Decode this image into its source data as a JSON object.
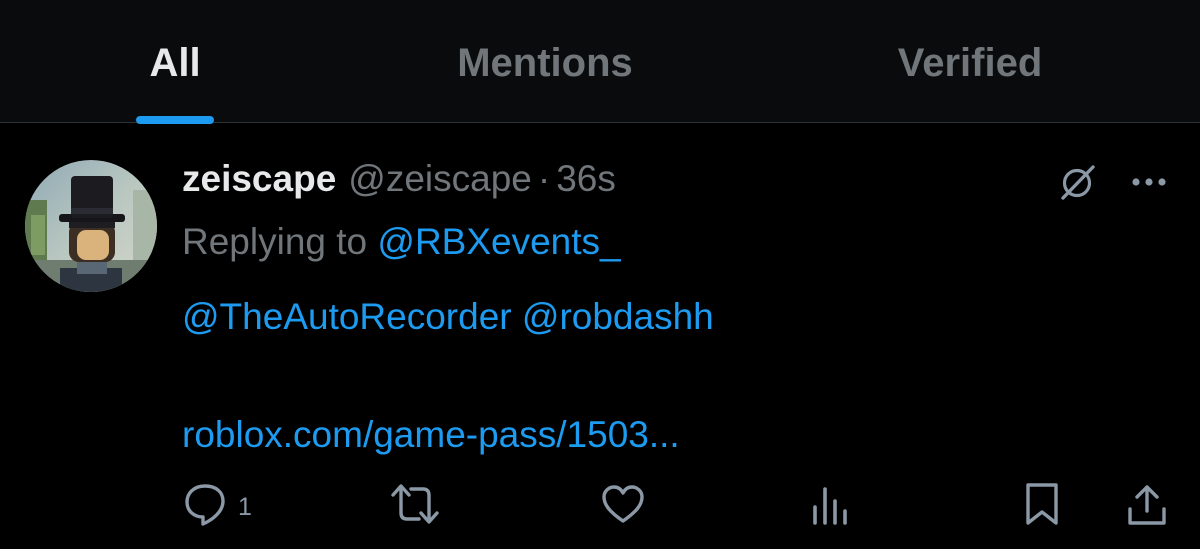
{
  "tabs": [
    {
      "label": "All",
      "active": true
    },
    {
      "label": "Mentions",
      "active": false
    },
    {
      "label": "Verified",
      "active": false
    }
  ],
  "tweet": {
    "display_name": "zeiscape",
    "handle": "@zeiscape",
    "separator": "·",
    "time": "36s",
    "replying_prefix": "Replying to ",
    "replying_to": "@RBXevents_",
    "mention_1": "@TheAutoRecorder",
    "mention_2": "@robdashh",
    "link_text": "roblox.com/game-pass/1503...",
    "reply_count": "1",
    "icons": [
      "grok-icon",
      "more-icon",
      "reply-icon",
      "retweet-icon",
      "like-icon",
      "views-icon",
      "bookmark-icon",
      "share-icon"
    ]
  },
  "colors": {
    "accent": "#1d9bf0",
    "muted": "#71767b",
    "text": "#e7e9ea",
    "background": "#000000",
    "header_background": "#0a0b0d"
  }
}
